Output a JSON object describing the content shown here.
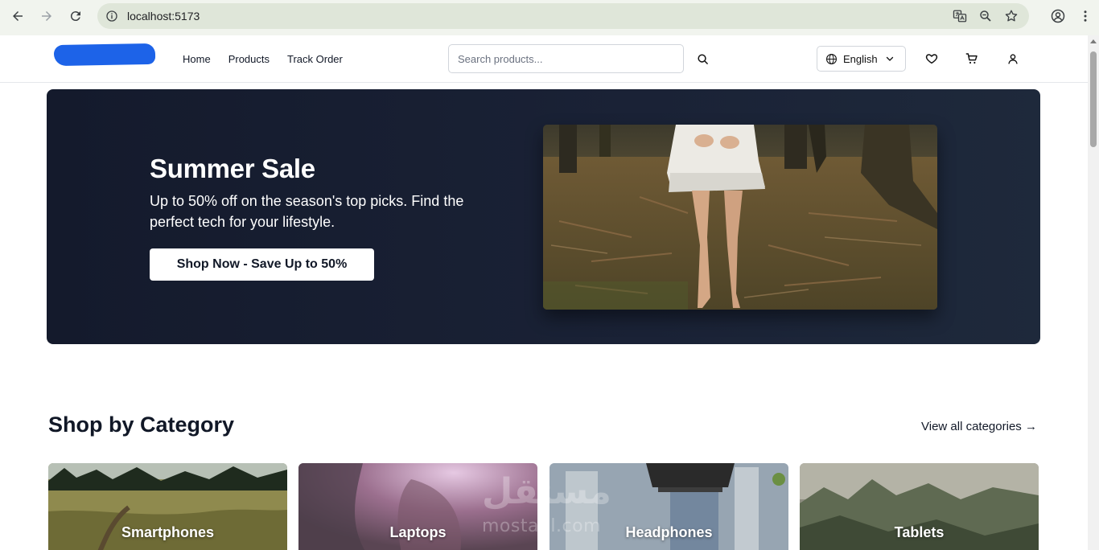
{
  "browser": {
    "url": "localhost:5173"
  },
  "header": {
    "nav": [
      "Home",
      "Products",
      "Track Order"
    ],
    "search_placeholder": "Search products...",
    "language": "English"
  },
  "hero": {
    "title": "Summer Sale",
    "subtitle": "Up to 50% off on the season's top picks. Find the perfect tech for your lifestyle.",
    "cta": "Shop Now - Save Up to 50%"
  },
  "categories": {
    "title": "Shop by Category",
    "view_all": "View all categories →",
    "items": [
      "Smartphones",
      "Laptops",
      "Headphones",
      "Tablets"
    ]
  },
  "watermark": {
    "arabic": "مستقل",
    "latin": "mostaql.com"
  },
  "colors": {
    "hero_bg": "#141a2c",
    "accent": "#1d63e8"
  }
}
